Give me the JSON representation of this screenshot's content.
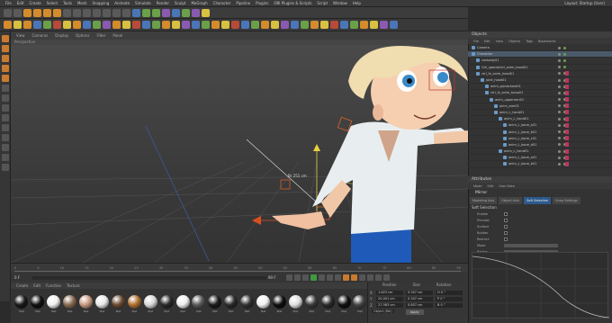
{
  "menubar": {
    "items": [
      "File",
      "Edit",
      "Create",
      "Select",
      "Tools",
      "Mesh",
      "Snapping",
      "Animate",
      "Simulate",
      "Render",
      "Sculpt",
      "MoGraph",
      "Character",
      "Pipeline",
      "Plugins",
      "OBI Plugins & Scripts",
      "Script",
      "Window",
      "Help"
    ],
    "layout_label": "Layout: Startup (User)"
  },
  "viewport": {
    "menu": [
      "View",
      "Cameras",
      "Display",
      "Options",
      "Filter",
      "Panel"
    ],
    "title": "Perspective",
    "distance_label": "Br 251 cm"
  },
  "timeline": {
    "ticks": [
      "0",
      "5",
      "10",
      "15",
      "20",
      "25",
      "30",
      "35",
      "40",
      "45",
      "50",
      "55",
      "60",
      "65",
      "70",
      "75",
      "80",
      "85",
      "90"
    ],
    "start": "0 F",
    "end": "90 F"
  },
  "materials": {
    "menu": [
      "Create",
      "Edit",
      "Function",
      "Texture"
    ],
    "items": [
      {
        "name": "Mat",
        "color": "#1a1a1a"
      },
      {
        "name": "Mat",
        "color": "#111"
      },
      {
        "name": "Mat",
        "color": "#f0f0f0"
      },
      {
        "name": "Mat",
        "color": "#8a6a50"
      },
      {
        "name": "Mat",
        "color": "#c89a80"
      },
      {
        "name": "Mat",
        "color": "#e8e8e8"
      },
      {
        "name": "Mat",
        "color": "#6a4a30"
      },
      {
        "name": "Mat",
        "color": "#b07030"
      },
      {
        "name": "Mat",
        "color": "#d8d8d8"
      },
      {
        "name": "Mat",
        "color": "#2a2a2a"
      },
      {
        "name": "Mat",
        "color": "#eeeeee"
      },
      {
        "name": "Mat",
        "color": "#5a5a5a"
      },
      {
        "name": "Mat",
        "color": "#1c1c1c"
      },
      {
        "name": "Mat",
        "color": "#2b2b2b"
      },
      {
        "name": "Mat",
        "color": "#333"
      },
      {
        "name": "Mat",
        "color": "#f2f2f2"
      },
      {
        "name": "Mat",
        "color": "#0f0f0f"
      },
      {
        "name": "Mat",
        "color": "#e0e0e0"
      },
      {
        "name": "Mat",
        "color": "#3a3a3a"
      },
      {
        "name": "Mat",
        "color": "#2a2a2a"
      },
      {
        "name": "Mat",
        "color": "#111"
      },
      {
        "name": "Mat",
        "color": "#444"
      }
    ]
  },
  "coords": {
    "headers": [
      "Position",
      "Size",
      "Rotation"
    ],
    "rows": [
      {
        "axis": "X",
        "pos": "1.623 cm",
        "size": "0.307 cm",
        "rot": "H  0 °"
      },
      {
        "axis": "Y",
        "pos": "20.001 cm",
        "size": "0.347 cm",
        "rot": "P  0 °"
      },
      {
        "axis": "Z",
        "pos": "27.583 cm",
        "size": "0.857 cm",
        "rot": "B  0 °"
      }
    ],
    "mode_label": "Object (Rel)",
    "apply_label": "Apply"
  },
  "objects": {
    "title": "Objects",
    "menu": [
      "File",
      "Edit",
      "View",
      "Objects",
      "Tags",
      "Bookmarks"
    ],
    "rows": [
      {
        "label": "Camera",
        "indent": 0
      },
      {
        "label": "Character",
        "indent": 0,
        "sel": true
      },
      {
        "label": "conbody01",
        "indent": 1
      },
      {
        "label": "Ctrl_specialctrl_anim_hood01",
        "indent": 1
      },
      {
        "label": "ctrl_fx_anim_hood01",
        "indent": 1
      },
      {
        "label": "joint_hood01",
        "indent": 2
      },
      {
        "label": "anim_spinechest01",
        "indent": 3
      },
      {
        "label": "ctrl_fx_anim_torso01",
        "indent": 3
      },
      {
        "label": "anim_upperarm01",
        "indent": 4
      },
      {
        "label": "anim_arm01",
        "indent": 5
      },
      {
        "label": "anim_L_hand01",
        "indent": 5
      },
      {
        "label": "anim_L_hand01",
        "indent": 6
      },
      {
        "label": "anim_L_bone_a01",
        "indent": 7
      },
      {
        "label": "anim_L_bone_b01",
        "indent": 7
      },
      {
        "label": "anim_L_bone_c01",
        "indent": 7
      },
      {
        "label": "anim_L_bone_d01",
        "indent": 7
      },
      {
        "label": "anim_L_hand01",
        "indent": 6
      },
      {
        "label": "anim_L_bone_a01",
        "indent": 7
      },
      {
        "label": "anim_L_bone_b01",
        "indent": 7
      }
    ]
  },
  "attributes": {
    "title": "Attributes",
    "menu": [
      "Mode",
      "Edit",
      "User Data"
    ],
    "object_label": "Mirror",
    "tabs": [
      "Modeling Axis",
      "Object Axis",
      "Soft Selection",
      "Snap Settings"
    ],
    "section": "Soft Selection",
    "rows": [
      {
        "label": "Enable"
      },
      {
        "label": "Preview"
      },
      {
        "label": "Surface"
      },
      {
        "label": "Rubber"
      },
      {
        "label": "Restrict"
      },
      {
        "label": "Mode"
      },
      {
        "label": "Radius"
      },
      {
        "label": "Strength"
      },
      {
        "label": "Width"
      }
    ]
  },
  "colors": {
    "accent": "#d48b2c",
    "selection": "#4b5a6b",
    "play_green": "#3f9a3f",
    "tab_active": "#2d5a8c"
  }
}
